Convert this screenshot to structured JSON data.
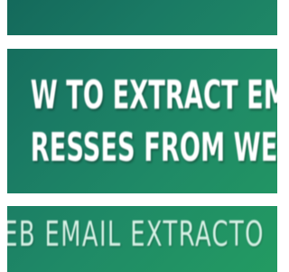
{
  "banner": {
    "headline_line_1": "W TO EXTRACT EMA",
    "headline_line_2": "RESSES FROM WEBS",
    "subtitle": "EB EMAIL EXTRACTO"
  },
  "colors": {
    "background_start": "#14695b",
    "background_end": "#239b62",
    "bar": "#ffffff",
    "text": "#ffffff"
  }
}
